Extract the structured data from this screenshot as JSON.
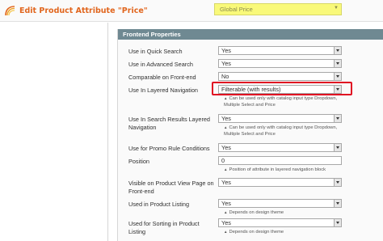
{
  "header": {
    "title": "Edit Product Attribute \"Price\"",
    "icon": "magento-swirl-icon",
    "scope": {
      "value": "Global Price"
    }
  },
  "section": {
    "title": "Frontend Properties"
  },
  "fields": [
    {
      "label": "Use in Quick Search",
      "type": "select",
      "value": "Yes"
    },
    {
      "label": "Use in Advanced Search",
      "type": "select",
      "value": "Yes"
    },
    {
      "label": "Comparable on Front-end",
      "type": "select",
      "value": "No"
    },
    {
      "label": "Use In Layered Navigation",
      "type": "select",
      "value": "Filterable (with results)",
      "highlighted": true,
      "note": [
        "Can be used only with catalog input type Dropdown,",
        "Multiple Select and Price"
      ]
    },
    {
      "label": "Use In Search Results Layered Navigation",
      "type": "select",
      "value": "Yes",
      "note": [
        "Can be used only with catalog input type Dropdown,",
        "Multiple Select and Price"
      ]
    },
    {
      "label": "Use for Promo Rule Conditions",
      "type": "select",
      "value": "Yes"
    },
    {
      "label": "Position",
      "type": "text",
      "value": "0",
      "note": [
        "Position of attribute in layered navigation block"
      ]
    },
    {
      "label": "Visible on Product View Page on Front-end",
      "type": "select",
      "value": "Yes"
    },
    {
      "label": "Used in Product Listing",
      "type": "select",
      "value": "Yes",
      "note": [
        "Depends on design theme"
      ]
    },
    {
      "label": "Used for Sorting in Product Listing",
      "type": "select",
      "value": "Yes",
      "note": [
        "Depends on design theme"
      ]
    }
  ],
  "colors": {
    "title": "#e1661e",
    "section_header": "#6f8992",
    "highlight": "#e00d22",
    "scope_bg": "#f9f97a"
  }
}
